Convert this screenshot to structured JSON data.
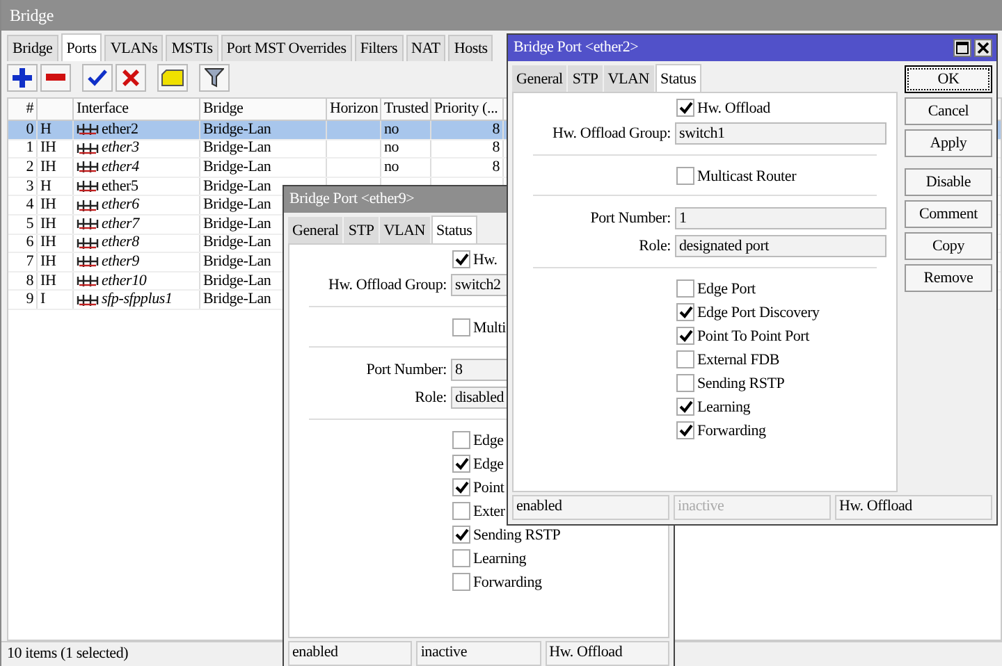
{
  "window": {
    "title": "Bridge"
  },
  "tabs": [
    {
      "label": "Bridge",
      "selected": false
    },
    {
      "label": "Ports",
      "selected": true
    },
    {
      "label": "VLANs",
      "selected": false
    },
    {
      "label": "MSTIs",
      "selected": false
    },
    {
      "label": "Port MST Overrides",
      "selected": false
    },
    {
      "label": "Filters",
      "selected": false
    },
    {
      "label": "NAT",
      "selected": false
    },
    {
      "label": "Hosts",
      "selected": false
    }
  ],
  "table": {
    "columns": [
      "#",
      "Interface",
      "Bridge",
      "Horizon",
      "Trusted",
      "Priority (..."
    ],
    "rows": [
      {
        "number": "0",
        "flags": "H",
        "interface": "ether2",
        "inactive": false,
        "bridge": "Bridge-Lan",
        "trusted": "no",
        "priority": "8",
        "selected": true
      },
      {
        "number": "1",
        "flags": "IH",
        "interface": "ether3",
        "inactive": true,
        "bridge": "Bridge-Lan",
        "trusted": "no",
        "priority": "8",
        "selected": false
      },
      {
        "number": "2",
        "flags": "IH",
        "interface": "ether4",
        "inactive": true,
        "bridge": "Bridge-Lan",
        "trusted": "no",
        "priority": "8",
        "selected": false
      },
      {
        "number": "3",
        "flags": "H",
        "interface": "ether5",
        "inactive": false,
        "bridge": "Bridge-Lan",
        "selected": false
      },
      {
        "number": "4",
        "flags": "IH",
        "interface": "ether6",
        "inactive": true,
        "bridge": "Bridge-Lan",
        "selected": false
      },
      {
        "number": "5",
        "flags": "IH",
        "interface": "ether7",
        "inactive": true,
        "bridge": "Bridge-Lan",
        "selected": false
      },
      {
        "number": "6",
        "flags": "IH",
        "interface": "ether8",
        "inactive": true,
        "bridge": "Bridge-Lan",
        "selected": false
      },
      {
        "number": "7",
        "flags": "IH",
        "interface": "ether9",
        "inactive": true,
        "bridge": "Bridge-Lan",
        "selected": false
      },
      {
        "number": "8",
        "flags": "IH",
        "interface": "ether10",
        "inactive": true,
        "bridge": "Bridge-Lan",
        "selected": false
      },
      {
        "number": "9",
        "flags": "I",
        "interface": "sfp-sfpplus1",
        "inactive": true,
        "bridge": "Bridge-Lan",
        "selected": false
      }
    ]
  },
  "status_bar": "10 items (1 selected)",
  "dialogs": [
    {
      "title": "Bridge Port <ether9>",
      "active": false,
      "tabs": [
        {
          "label": "General",
          "selected": false
        },
        {
          "label": "STP",
          "selected": false
        },
        {
          "label": "VLAN",
          "selected": false
        },
        {
          "label": "Status",
          "selected": true
        }
      ],
      "items": [
        {
          "kind": "checkbox",
          "label": "Hw.",
          "checked": true
        },
        {
          "kind": "field",
          "label": "Hw. Offload Group:",
          "value": "switch2"
        },
        {
          "kind": "separator"
        },
        {
          "kind": "checkbox",
          "label": "Multi",
          "checked": false
        },
        {
          "kind": "separator"
        },
        {
          "kind": "field",
          "label": "Port Number:",
          "value": "8"
        },
        {
          "kind": "field",
          "label": "Role:",
          "value": "disabled"
        },
        {
          "kind": "separator"
        },
        {
          "kind": "checkbox",
          "label": "Edge",
          "checked": false
        },
        {
          "kind": "checkbox",
          "label": "Edge",
          "checked": true
        },
        {
          "kind": "checkbox",
          "label": "Point",
          "checked": true
        },
        {
          "kind": "checkbox",
          "label": "Exter",
          "checked": false
        },
        {
          "kind": "checkbox",
          "label": "Sending RSTP",
          "checked": true
        },
        {
          "kind": "checkbox",
          "label": "Learning",
          "checked": false
        },
        {
          "kind": "checkbox",
          "label": "Forwarding",
          "checked": false
        }
      ],
      "status": [
        {
          "text": "enabled",
          "dim": false
        },
        {
          "text": "inactive",
          "dim": false
        },
        {
          "text": "Hw. Offload",
          "dim": false
        }
      ]
    },
    {
      "title": "Bridge Port <ether2>",
      "active": true,
      "tabs": [
        {
          "label": "General",
          "selected": false
        },
        {
          "label": "STP",
          "selected": false
        },
        {
          "label": "VLAN",
          "selected": false
        },
        {
          "label": "Status",
          "selected": true
        }
      ],
      "items": [
        {
          "kind": "checkbox",
          "label": "Hw. Offload",
          "checked": true
        },
        {
          "kind": "field",
          "label": "Hw. Offload Group:",
          "value": "switch1"
        },
        {
          "kind": "separator"
        },
        {
          "kind": "checkbox",
          "label": "Multicast Router",
          "checked": false
        },
        {
          "kind": "separator"
        },
        {
          "kind": "field",
          "label": "Port Number:",
          "value": "1"
        },
        {
          "kind": "field",
          "label": "Role:",
          "value": "designated port"
        },
        {
          "kind": "separator"
        },
        {
          "kind": "checkbox",
          "label": "Edge Port",
          "checked": false
        },
        {
          "kind": "checkbox",
          "label": "Edge Port Discovery",
          "checked": true
        },
        {
          "kind": "checkbox",
          "label": "Point To Point Port",
          "checked": true
        },
        {
          "kind": "checkbox",
          "label": "External FDB",
          "checked": false
        },
        {
          "kind": "checkbox",
          "label": "Sending RSTP",
          "checked": false
        },
        {
          "kind": "checkbox",
          "label": "Learning",
          "checked": true
        },
        {
          "kind": "checkbox",
          "label": "Forwarding",
          "checked": true
        }
      ],
      "buttons": [
        {
          "label": "OK",
          "focused": true
        },
        {
          "label": "Cancel",
          "focused": false
        },
        {
          "label": "Apply",
          "focused": false
        },
        {
          "label": "Disable",
          "focused": false
        },
        {
          "label": "Comment",
          "focused": false
        },
        {
          "label": "Copy",
          "focused": false
        },
        {
          "label": "Remove",
          "focused": false
        }
      ],
      "status": [
        {
          "text": "enabled",
          "dim": false
        },
        {
          "text": "inactive",
          "dim": true
        },
        {
          "text": "Hw. Offload",
          "dim": false
        }
      ]
    }
  ]
}
